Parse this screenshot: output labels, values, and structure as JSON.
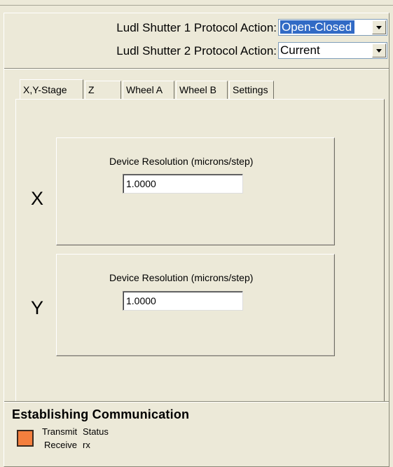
{
  "protocol": {
    "shutter1_label": "Ludl Shutter 1 Protocol Action:",
    "shutter1_value": "Open-Closed",
    "shutter2_label": "Ludl Shutter 2 Protocol Action:",
    "shutter2_value": "Current"
  },
  "tabs": [
    {
      "label": "X,Y-Stage",
      "active": true
    },
    {
      "label": "Z",
      "active": false
    },
    {
      "label": "Wheel A",
      "active": false
    },
    {
      "label": "Wheel B",
      "active": false
    },
    {
      "label": "Settings",
      "active": false
    }
  ],
  "axes": {
    "x": {
      "letter": "X",
      "res_label": "Device Resolution (microns/step)",
      "res_value": "1.0000"
    },
    "y": {
      "letter": "Y",
      "res_label": "Device Resolution (microns/step)",
      "res_value": "1.0000"
    }
  },
  "status": {
    "title": "Establishing Communication",
    "led_color": "#f47f3e",
    "transmit_label": "Transmit",
    "transmit_value": "Status",
    "receive_label": "Receive",
    "receive_value": "rx"
  }
}
